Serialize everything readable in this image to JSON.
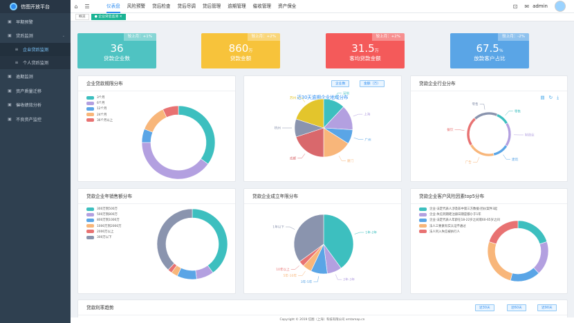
{
  "brand": {
    "name": "信图开放平台"
  },
  "sidebar": {
    "items": [
      {
        "label": "早期预警",
        "icon": "warning-icon"
      },
      {
        "label": "贷后监测",
        "icon": "monitor-icon",
        "open": true
      },
      {
        "label": "企业贷后监测",
        "sub": true,
        "active": true
      },
      {
        "label": "个人贷后监测",
        "sub": true
      },
      {
        "label": "逾期监测",
        "icon": "clock-icon"
      },
      {
        "label": "资产质量迁移",
        "icon": "transfer-icon"
      },
      {
        "label": "催收绩效分析",
        "icon": "chart-icon"
      },
      {
        "label": "不良资产监控",
        "icon": "alert-icon"
      }
    ]
  },
  "topbar": {
    "menu": [
      "仪表盘",
      "风险预警",
      "贷后检查",
      "贷后尽调",
      "贷后管理",
      "逾期管理",
      "催收管理",
      "资产保全"
    ],
    "active": 0,
    "user": "admin"
  },
  "tabs": [
    "概览",
    "企业贷后监测"
  ],
  "stats": [
    {
      "value": "36",
      "unit": "",
      "label": "贷款企业数",
      "compare": "较上月：+1%",
      "color": "#4fc3c2"
    },
    {
      "value": "860",
      "unit": "万",
      "label": "贷款金额",
      "compare": "较上月：+2%",
      "color": "#f7c33b"
    },
    {
      "value": "31.5",
      "unit": "万",
      "label": "客均贷款金额",
      "compare": "较上月：+2%",
      "color": "#f45a5a"
    },
    {
      "value": "67.5",
      "unit": "%",
      "label": "放款客户占比",
      "compare": "较上月：-2%",
      "color": "#5aa5e6"
    }
  ],
  "panels": {
    "term": {
      "title": "企业贷款期限分布"
    },
    "region": {
      "title": "近30天逾期企业地域分布",
      "btn1": "企业数",
      "btn2": "金额（万）"
    },
    "industry": {
      "title": "贷款企业行业分布"
    },
    "sales": {
      "title": "贷款企业年销售额分布"
    },
    "age": {
      "title": "贷款企业成立年限分布"
    },
    "risk": {
      "title": "贷款企业客户风险因素top5分布"
    },
    "rate": {
      "title": "贷款利率趋势",
      "btns": [
        "近30天",
        "近60天",
        "近90天"
      ]
    }
  },
  "chart_data": [
    {
      "type": "pie",
      "title": "企业贷款期限分布",
      "donut": true,
      "slices": [
        {
          "name": "3个月",
          "value": 35,
          "color": "#3dbfbf"
        },
        {
          "name": "6个月",
          "value": 40,
          "color": "#b3a0e0"
        },
        {
          "name": "12个月",
          "value": 6,
          "color": "#5aa5e6"
        },
        {
          "name": "24个月",
          "value": 12,
          "color": "#f8b67a"
        },
        {
          "name": "36个月以上",
          "value": 7,
          "color": "#e87272"
        }
      ]
    },
    {
      "type": "pie",
      "title": "近30天逾期企业地域分布",
      "slices": [
        {
          "name": "深圳",
          "value": 12,
          "color": "#3dbfbf"
        },
        {
          "name": "上海",
          "value": 14,
          "color": "#b3a0e0"
        },
        {
          "name": "广州",
          "value": 8,
          "color": "#5aa5e6"
        },
        {
          "name": "厦门",
          "value": 16,
          "color": "#f8b67a"
        },
        {
          "name": "成都",
          "value": 20,
          "color": "#d9686c"
        },
        {
          "name": "杭州",
          "value": 10,
          "color": "#8a94ae"
        },
        {
          "name": "苏州",
          "value": 20,
          "color": "#e3c52c"
        }
      ]
    },
    {
      "type": "pie",
      "title": "贷款企业行业分布",
      "donut": true,
      "slices": [
        {
          "name": "零售",
          "value": 10,
          "color": "#3dbfbf"
        },
        {
          "name": "制造业",
          "value": 18,
          "color": "#b3a0e0"
        },
        {
          "name": "建筑",
          "value": 12,
          "color": "#5aa5e6"
        },
        {
          "name": "广告",
          "value": 20,
          "color": "#f8b67a"
        },
        {
          "name": "餐饮",
          "value": 22,
          "color": "#e87272"
        },
        {
          "name": "零售",
          "value": 18,
          "color": "#8a94ae"
        }
      ]
    },
    {
      "type": "pie",
      "title": "贷款企业年销售额分布",
      "donut": true,
      "slices": [
        {
          "name": "300万到500万",
          "value": 40,
          "color": "#3dbfbf"
        },
        {
          "name": "500万到800万",
          "value": 8,
          "color": "#b3a0e0"
        },
        {
          "name": "800万到1000万",
          "value": 9,
          "color": "#5aa5e6"
        },
        {
          "name": "1000万到2000万",
          "value": 3,
          "color": "#f8b67a"
        },
        {
          "name": "2000万以上",
          "value": 2,
          "color": "#e87272"
        },
        {
          "name": "300万以下",
          "value": 38,
          "color": "#8a94ae"
        }
      ]
    },
    {
      "type": "pie",
      "title": "贷款企业成立年限分布",
      "slices": [
        {
          "name": "1年-2年",
          "value": 40,
          "color": "#3dbfbf"
        },
        {
          "name": "2年-3年",
          "value": 8,
          "color": "#b3a0e0"
        },
        {
          "name": "3年-5年",
          "value": 9,
          "color": "#5aa5e6"
        },
        {
          "name": "5年-10年",
          "value": 5,
          "color": "#f8b67a"
        },
        {
          "name": "10年以上",
          "value": 3,
          "color": "#e87272"
        },
        {
          "name": "1年以下",
          "value": 35,
          "color": "#8a94ae"
        }
      ]
    },
    {
      "type": "pie",
      "title": "贷款企业客户风险因素top5分布",
      "donut": true,
      "slices": [
        {
          "name": "企业-法定代表人涉及非中第三方数据-团伙案件3起",
          "value": 20,
          "color": "#3dbfbf"
        },
        {
          "name": "企业-失信到期距注册日期是都小于1年",
          "value": 18,
          "color": "#b3a0e0"
        },
        {
          "name": "企业-法定代表人年龄在18-22岁之间或60-65岁之间",
          "value": 16,
          "color": "#5aa5e6"
        },
        {
          "name": "法人三要素有实认证不通过",
          "value": 26,
          "color": "#f8b67a"
        },
        {
          "name": "法人列入失信被执行人",
          "value": 20,
          "color": "#e87272"
        }
      ]
    }
  ],
  "footer": "Copyright © 2019 信图（上海）科技有限公司 xmtamap.cn"
}
